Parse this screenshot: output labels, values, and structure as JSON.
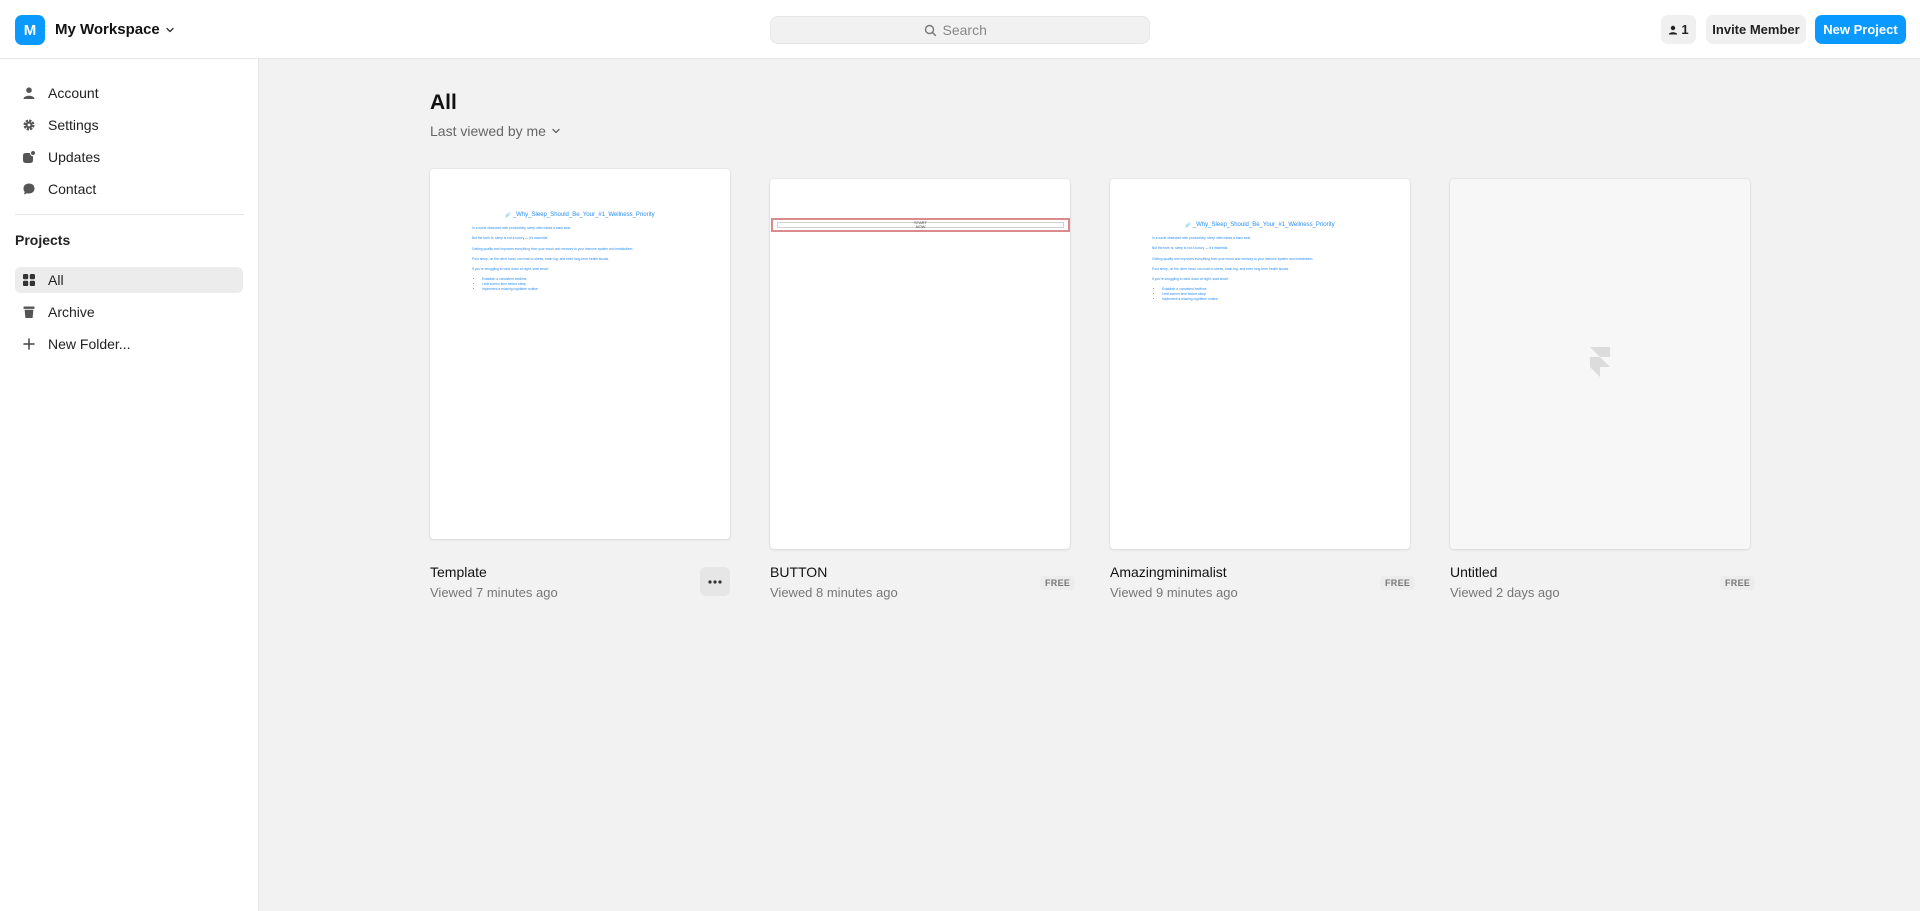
{
  "workspace": {
    "initial": "M",
    "name": "My Workspace"
  },
  "search": {
    "placeholder": "Search"
  },
  "header": {
    "member_count": "1",
    "invite_label": "Invite Member",
    "new_project_label": "New Project"
  },
  "sidebar": {
    "items": [
      {
        "label": "Account",
        "icon": "user-icon"
      },
      {
        "label": "Settings",
        "icon": "gear-icon"
      },
      {
        "label": "Updates",
        "icon": "updates-icon"
      },
      {
        "label": "Contact",
        "icon": "chat-bubble-icon"
      }
    ],
    "projects_label": "Projects",
    "project_items": [
      {
        "label": "All",
        "icon": "grid-icon",
        "active": true
      },
      {
        "label": "Archive",
        "icon": "trash-icon"
      },
      {
        "label": "New Folder...",
        "icon": "plus-icon"
      }
    ]
  },
  "main": {
    "title": "All",
    "sort_label": "Last viewed by me",
    "projects": [
      {
        "name": "Template",
        "viewed": "Viewed 7 minutes ago",
        "badge": ""
      },
      {
        "name": "BUTTON",
        "viewed": "Viewed 8 minutes ago",
        "badge": "FREE"
      },
      {
        "name": "Amazingminimalist",
        "viewed": "Viewed 9 minutes ago",
        "badge": "FREE"
      },
      {
        "name": "Untitled",
        "viewed": "Viewed 2 days ago",
        "badge": "FREE"
      }
    ],
    "doc_preview": {
      "title": "☄️_Why_Sleep_Should_Be_Your_#1_Wellness_Priority",
      "paragraphs": [
        "In a world obsessed with productivity, sleep often takes a back seat.",
        "But the truth is: sleep is not a luxury — it's essential.",
        "Getting quality rest improves everything from your mood and memory to your immune system and metabolism.",
        "Poor sleep, on the other hand, can lead to stress, brain fog, and even long-term health issues.",
        "If you're struggling to wind down at night, start small:"
      ],
      "bullets": [
        "Establish a consistent bedtime",
        "Limit screen time before sleep",
        "Implement a relaxing nighttime routine"
      ]
    },
    "button_preview": {
      "line1": "START",
      "line2": "NOW"
    }
  },
  "colors": {
    "accent": "#0a99ff",
    "doc_text": "#2a8ef5"
  }
}
